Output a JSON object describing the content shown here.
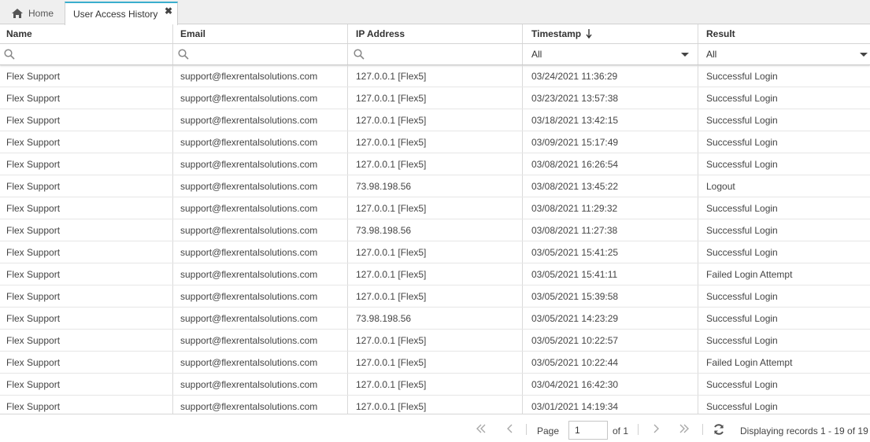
{
  "tabs": [
    {
      "label": "Home",
      "icon": "home-icon"
    },
    {
      "label": "User Access History",
      "active": true,
      "close_glyph": "✖"
    }
  ],
  "grid": {
    "columns": [
      {
        "key": "name",
        "label": "Name"
      },
      {
        "key": "email",
        "label": "Email"
      },
      {
        "key": "ip",
        "label": "IP Address"
      },
      {
        "key": "timestamp",
        "label": "Timestamp",
        "sort": "descending"
      },
      {
        "key": "result",
        "label": "Result"
      }
    ],
    "filters": {
      "name": "",
      "email": "",
      "ip": "",
      "timestamp": "All",
      "result": "All"
    },
    "rows": [
      {
        "name": "Flex Support",
        "email": "support@flexrentalsolutions.com",
        "ip": "127.0.0.1 [Flex5]",
        "timestamp": "03/24/2021 11:36:29",
        "result": "Successful Login"
      },
      {
        "name": "Flex Support",
        "email": "support@flexrentalsolutions.com",
        "ip": "127.0.0.1 [Flex5]",
        "timestamp": "03/23/2021 13:57:38",
        "result": "Successful Login"
      },
      {
        "name": "Flex Support",
        "email": "support@flexrentalsolutions.com",
        "ip": "127.0.0.1 [Flex5]",
        "timestamp": "03/18/2021 13:42:15",
        "result": "Successful Login"
      },
      {
        "name": "Flex Support",
        "email": "support@flexrentalsolutions.com",
        "ip": "127.0.0.1 [Flex5]",
        "timestamp": "03/09/2021 15:17:49",
        "result": "Successful Login"
      },
      {
        "name": "Flex Support",
        "email": "support@flexrentalsolutions.com",
        "ip": "127.0.0.1 [Flex5]",
        "timestamp": "03/08/2021 16:26:54",
        "result": "Successful Login"
      },
      {
        "name": "Flex Support",
        "email": "support@flexrentalsolutions.com",
        "ip": "73.98.198.56",
        "timestamp": "03/08/2021 13:45:22",
        "result": "Logout"
      },
      {
        "name": "Flex Support",
        "email": "support@flexrentalsolutions.com",
        "ip": "127.0.0.1 [Flex5]",
        "timestamp": "03/08/2021 11:29:32",
        "result": "Successful Login"
      },
      {
        "name": "Flex Support",
        "email": "support@flexrentalsolutions.com",
        "ip": "73.98.198.56",
        "timestamp": "03/08/2021 11:27:38",
        "result": "Successful Login"
      },
      {
        "name": "Flex Support",
        "email": "support@flexrentalsolutions.com",
        "ip": "127.0.0.1 [Flex5]",
        "timestamp": "03/05/2021 15:41:25",
        "result": "Successful Login"
      },
      {
        "name": "Flex Support",
        "email": "support@flexrentalsolutions.com",
        "ip": "127.0.0.1 [Flex5]",
        "timestamp": "03/05/2021 15:41:11",
        "result": "Failed Login Attempt"
      },
      {
        "name": "Flex Support",
        "email": "support@flexrentalsolutions.com",
        "ip": "127.0.0.1 [Flex5]",
        "timestamp": "03/05/2021 15:39:58",
        "result": "Successful Login"
      },
      {
        "name": "Flex Support",
        "email": "support@flexrentalsolutions.com",
        "ip": "73.98.198.56",
        "timestamp": "03/05/2021 14:23:29",
        "result": "Successful Login"
      },
      {
        "name": "Flex Support",
        "email": "support@flexrentalsolutions.com",
        "ip": "127.0.0.1 [Flex5]",
        "timestamp": "03/05/2021 10:22:57",
        "result": "Successful Login"
      },
      {
        "name": "Flex Support",
        "email": "support@flexrentalsolutions.com",
        "ip": "127.0.0.1 [Flex5]",
        "timestamp": "03/05/2021 10:22:44",
        "result": "Failed Login Attempt"
      },
      {
        "name": "Flex Support",
        "email": "support@flexrentalsolutions.com",
        "ip": "127.0.0.1 [Flex5]",
        "timestamp": "03/04/2021 16:42:30",
        "result": "Successful Login"
      },
      {
        "name": "Flex Support",
        "email": "support@flexrentalsolutions.com",
        "ip": "127.0.0.1 [Flex5]",
        "timestamp": "03/01/2021 14:19:34",
        "result": "Successful Login"
      }
    ]
  },
  "pager": {
    "page_label": "Page",
    "page_value": "1",
    "of_label": "of 1",
    "display_text": "Displaying records 1 - 19 of 19",
    "icons": [
      "first-page-icon",
      "prev-page-icon",
      "next-page-icon",
      "last-page-icon",
      "refresh-icon"
    ]
  },
  "colors": {
    "accent": "#3aaecd",
    "tabbar_bg": "#efefef",
    "pager_icon": "#a8a8a8"
  }
}
